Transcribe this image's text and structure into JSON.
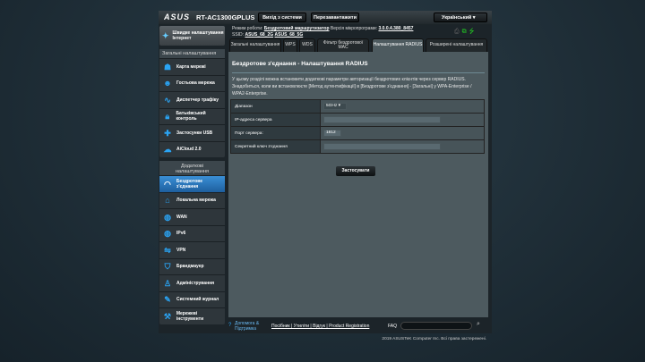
{
  "header": {
    "brand": "ASUS",
    "model": "RT-AC1300GPLUS",
    "logout": "Вихід з системи",
    "reboot": "Перезавантажити",
    "language": "Український",
    "mode_label": "Режим роботи:",
    "mode_value": "Бездротовий маршрутизатор",
    "fw_label": "Версія мікропрограми:",
    "fw_value": "3.0.0.4.380_8457",
    "ssid_label": "SSID:",
    "ssid_24": "ASUS_68_2G",
    "ssid_5": "ASUS_68_5G"
  },
  "sidebar": {
    "qis": "Швидке налаштування Інтернет",
    "general_head": "Загальні налаштування",
    "general": [
      {
        "label": "Карта мережі",
        "icon": "network-map-icon"
      },
      {
        "label": "Гостьова мережа",
        "icon": "guest-network-icon"
      },
      {
        "label": "Диспетчер трафіку",
        "icon": "traffic-icon"
      },
      {
        "label": "Батьківський контроль",
        "icon": "lock-icon"
      },
      {
        "label": "Застосунки USB",
        "icon": "puzzle-icon"
      },
      {
        "label": "AiCloud 2.0",
        "icon": "cloud-icon"
      }
    ],
    "advanced_head": "Додаткові налаштування",
    "advanced": [
      {
        "label": "Бездротове з'єднання",
        "icon": "wifi-icon"
      },
      {
        "label": "Локальна мережа",
        "icon": "home-icon"
      },
      {
        "label": "WAN",
        "icon": "globe-icon"
      },
      {
        "label": "IPv6",
        "icon": "globe-icon"
      },
      {
        "label": "VPN",
        "icon": "vpn-icon"
      },
      {
        "label": "Брандмауер",
        "icon": "shield-icon"
      },
      {
        "label": "Адміністрування",
        "icon": "admin-icon"
      },
      {
        "label": "Системний журнал",
        "icon": "log-icon"
      },
      {
        "label": "Мережеві інструменти",
        "icon": "tools-icon"
      }
    ]
  },
  "tabs": [
    "Загальні налаштування",
    "WPS",
    "WDS",
    "Фільтр бездротової MAC",
    "Налаштування RADIUS",
    "Розширені налаштування"
  ],
  "main": {
    "title": "Бездротове з'єднання - Налаштування RADIUS",
    "description": "У цьому розділі можна встановити додаткові параметри авторизації бездротових клієнтів через сервер RADIUS. Знадобиться, коли ви встановлюєте [Метод аутентифікації] в [Бездротове з'єднання] - [Загальні] у WPA-Enterprise / WPA2-Enterprise.",
    "fields": [
      {
        "label": "Діапазон",
        "value": "5GHz ▾"
      },
      {
        "label": "IP-адреса сервера",
        "value": ""
      },
      {
        "label": "Порт сервера:",
        "value": "1812"
      },
      {
        "label": "Секретний ключ з'єднання",
        "value": ""
      }
    ],
    "apply": "Застосувати"
  },
  "footer": {
    "help": "Допомога & Підтримка",
    "links": "Посібник | Утиліти | Відгук | Product Registration",
    "faq": "FAQ",
    "copyright": "2019 ASUSTeK Computer Inc. Всі права застережені."
  }
}
